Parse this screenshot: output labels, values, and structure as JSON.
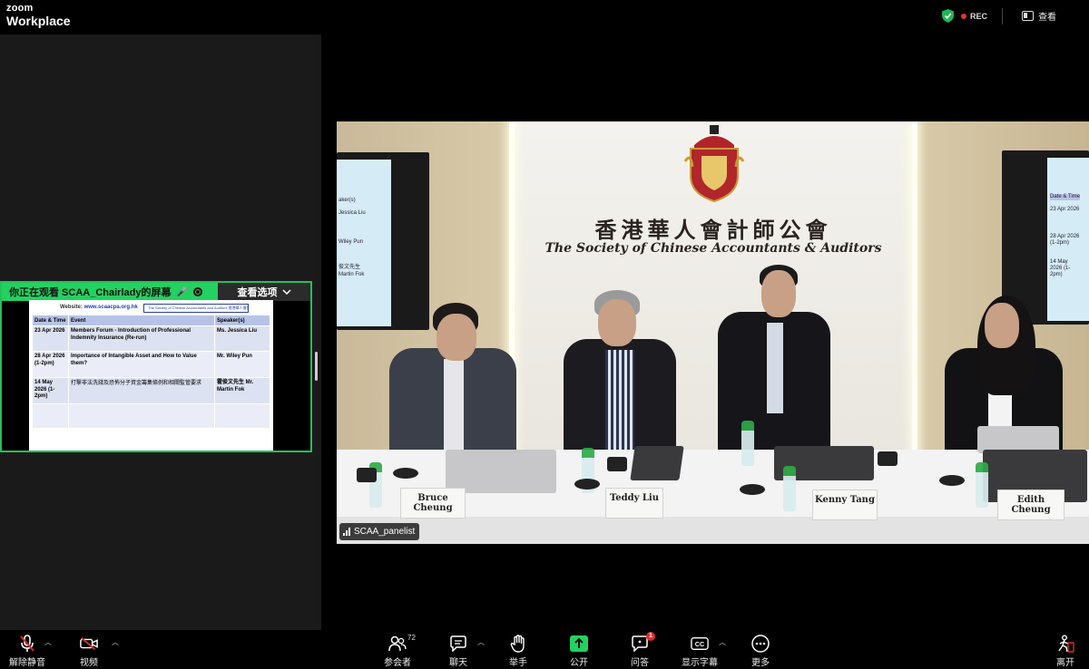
{
  "app": {
    "brand_top": "zoom",
    "brand_bottom": "Workplace"
  },
  "topbar": {
    "rec_label": "REC",
    "view_label": "查看"
  },
  "share": {
    "banner_text": "你正在观看 SCAA_Chairlady的屏幕",
    "view_options_label": "查看选项",
    "doc": {
      "website_label": "Website:",
      "website_url": "www.scaacpa.org.hk",
      "logo_text": "The Society of Chinese Accountants and Auditors 香港華人會計師公會",
      "columns": [
        "Date & Time",
        "Event",
        "Speaker(s)"
      ],
      "rows": [
        {
          "date": "23 Apr 2026",
          "event": "Members Forum - Introduction of Professional Indemnity Insurance (Re-run)",
          "speaker": "Ms. Jessica Liu"
        },
        {
          "date": "28 Apr 2026 (1-2pm)",
          "event": "Importance of Intangible Asset and How to Value them?",
          "speaker": "Mr. Wiley Pun"
        },
        {
          "date": "14 May 2026 (1-2pm)",
          "event": "打擊非法洗錢及恐怖分子資金籌集條例和相關監管要求",
          "speaker": "霍俊文先生 Mr. Martin Fok"
        },
        {
          "date": "",
          "event": "",
          "speaker": ""
        }
      ]
    }
  },
  "video": {
    "participant_label": "SCAA_panelist",
    "org_name_cn": "香港華人會計師公會",
    "org_name_en": "The Society of Chinese Accountants & Auditors",
    "left_screen_lines": [
      "aker(s)",
      "Jessica Liu",
      "Wiley Pun",
      "俊文先生",
      "Martin Fok"
    ],
    "right_screen_lines": [
      "Date & Time",
      "23 Apr 2026",
      "28 Apr 2026 (1-2pm)",
      "14 May 2026 (1-2pm)"
    ],
    "nameplates": [
      {
        "name": "Bruce Cheung"
      },
      {
        "name": "Teddy Liu"
      },
      {
        "name": "Kenny Tang"
      },
      {
        "name": "Edith Cheung"
      }
    ]
  },
  "toolbar": {
    "unmute": "解除静音",
    "video": "视频",
    "participants": "参会者",
    "participants_count": "72",
    "chat": "聊天",
    "raise_hand": "举手",
    "share": "公开",
    "qa": "问答",
    "qa_badge": "1",
    "captions": "显示字幕",
    "more": "更多",
    "leave": "离开"
  },
  "colors": {
    "accent_green": "#23d160",
    "rec_red": "#e5362f",
    "leave_red": "#e02d2d"
  }
}
